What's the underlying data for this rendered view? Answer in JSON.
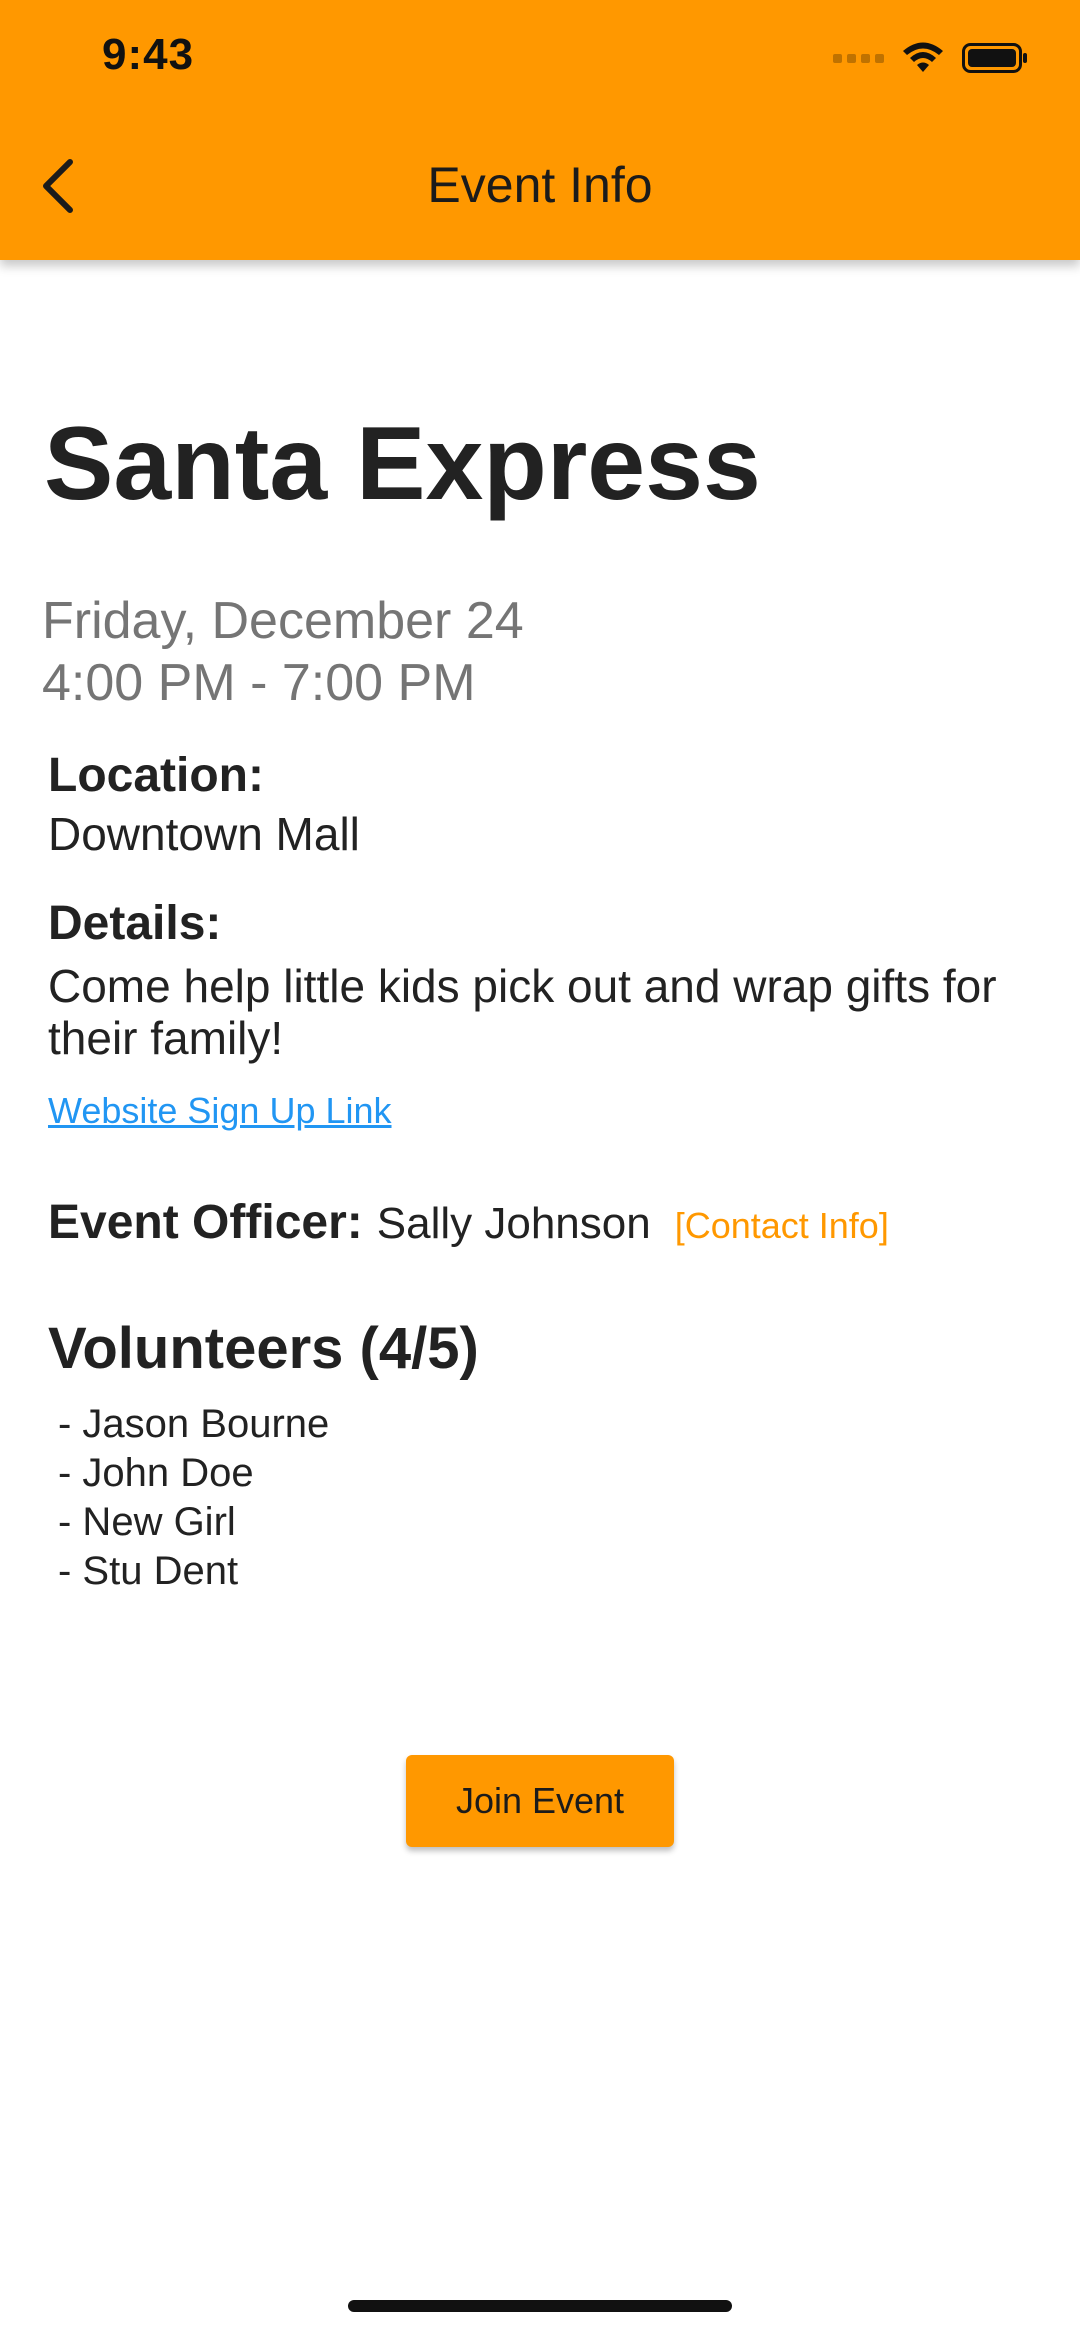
{
  "status_bar": {
    "time": "9:43",
    "icons": [
      "signal-dots-icon",
      "wifi-icon",
      "battery-icon"
    ]
  },
  "header": {
    "title": "Event Info",
    "back_icon": "chevron-left-icon",
    "background_color": "#FF9800"
  },
  "event": {
    "title": "Santa Express",
    "date": "Friday, December 24",
    "time_range": "4:00 PM - 7:00 PM",
    "location_label": "Location:",
    "location": "Downtown Mall",
    "details_label": "Details:",
    "details": "Come help little kids pick out and wrap gifts for their family!",
    "signup_link": "Website Sign Up Link",
    "officer_label": "Event Officer:",
    "officer_name": "Sally Johnson",
    "contact_link": "[Contact Info]"
  },
  "volunteers": {
    "title": "Volunteers (4/5)",
    "items": [
      "- Jason Bourne",
      "- John Doe",
      "- New Girl",
      "- Stu Dent"
    ]
  },
  "actions": {
    "join_label": "Join Event"
  },
  "colors": {
    "accent": "#FF9800",
    "link": "#2196F3",
    "muted_text": "#757575"
  }
}
